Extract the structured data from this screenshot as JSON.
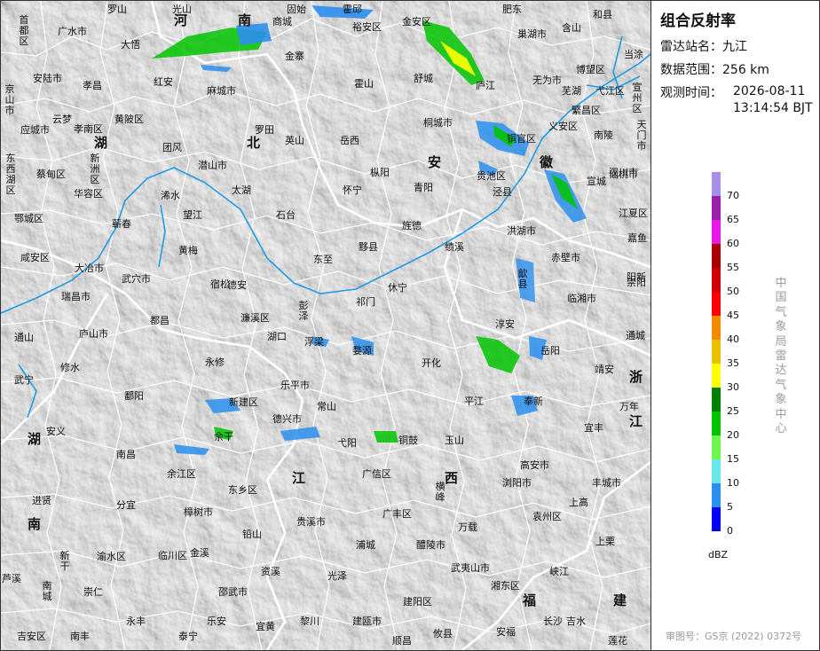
{
  "panel": {
    "title": "组合反射率",
    "station_label": "雷达站名：",
    "station_value": "九江",
    "range_label": "数据范围：",
    "range_value": "256 km",
    "time_label": "观测时间：",
    "time_date": "2026-08-11",
    "time_clock": "13:14:54 BJT",
    "legend_unit": "dBZ",
    "legend_ticks": [
      "70",
      "65",
      "60",
      "55",
      "50",
      "45",
      "40",
      "35",
      "30",
      "25",
      "20",
      "15",
      "10",
      "5",
      "0"
    ],
    "legend_colors": [
      "#a78ee6",
      "#9a1fa8",
      "#ea17ea",
      "#a70000",
      "#cc0000",
      "#ff0000",
      "#f18c00",
      "#e7c000",
      "#ffff00",
      "#007e00",
      "#01c400",
      "#6ff54f",
      "#6ae7ea",
      "#2c8eed",
      "#0000f6"
    ],
    "organization": "中国气象局雷达气象中心",
    "review_number": "审图号：GS京 (2022) 0372号"
  },
  "colors": {
    "map_background": "#e6e6e6",
    "boundary": "#ffffff",
    "river": "#1e9be6"
  },
  "provinces": [
    "河",
    "南",
    "湖",
    "北",
    "安",
    "徽",
    "浙",
    "江",
    "湖",
    "南",
    "江",
    "西",
    "福",
    "建"
  ],
  "places": [
    "罗山",
    "光山",
    "固始",
    "霍邱",
    "金安区",
    "肥东",
    "和县",
    "首都区",
    "广水市",
    "大悟",
    "商城",
    "裕安区",
    "巢湖市",
    "含山",
    "当涂",
    "金寨",
    "舒城",
    "博望区",
    "京山市",
    "安陆市",
    "孝昌",
    "红安",
    "麻城市",
    "霍山",
    "庐江",
    "无为市",
    "芜湖",
    "弋江区",
    "宣州区",
    "云梦",
    "应城市",
    "孝南区",
    "黄陂区",
    "罗田",
    "英山",
    "岳西",
    "桐城市",
    "铜官区",
    "义安区",
    "繁昌区",
    "南陵",
    "天门市",
    "东西湖区",
    "新洲区",
    "团风",
    "潜山市",
    "枞阳",
    "宣城",
    "汉川市",
    "蔡甸区",
    "华容区",
    "浠水",
    "太湖",
    "怀宁",
    "青阳",
    "贵池区",
    "泾县",
    "仙桃市",
    "江夏区",
    "鄂城区",
    "蕲春",
    "望江",
    "石台",
    "旌德",
    "洪湖市",
    "嘉鱼",
    "咸安区",
    "大冶市",
    "武穴市",
    "黄梅",
    "宿松",
    "东至",
    "黟县",
    "绩溪",
    "赤壁市",
    "阳新",
    "瑞昌市",
    "德安",
    "濂溪区",
    "湖口",
    "彭泽",
    "祁门",
    "休宁",
    "歙县",
    "临湘市",
    "崇阳",
    "通山",
    "庐山市",
    "都昌",
    "浮梁",
    "婺源",
    "淳安",
    "岳阳",
    "通城",
    "武宁",
    "修水",
    "永修",
    "鄱阳",
    "乐平市",
    "开化",
    "平江",
    "靖安",
    "安义",
    "新建区",
    "德兴市",
    "常山",
    "奉新",
    "万年",
    "余干",
    "玉山",
    "铜鼓",
    "宜丰",
    "南昌",
    "余江区",
    "弋阳",
    "横峰",
    "浏阳市",
    "高安市",
    "进贤",
    "东乡区",
    "广信区",
    "广丰区",
    "上高",
    "丰城市",
    "樟树市",
    "贵溪市",
    "铅山",
    "万载",
    "袁州区",
    "分宜",
    "渝水区",
    "临川区",
    "金溪",
    "浦城",
    "醴陵市",
    "上栗",
    "芦溪",
    "新干",
    "崇仁",
    "资溪",
    "光泽",
    "武夷山市",
    "湘东区",
    "峡江",
    "南城",
    "邵武市",
    "建阳区",
    "安福",
    "吉水",
    "永丰",
    "乐安",
    "宜黄",
    "黎川",
    "建瓯市",
    "攸县",
    "莲花",
    "吉安区",
    "南丰",
    "泰宁",
    "顺昌",
    "长沙"
  ]
}
